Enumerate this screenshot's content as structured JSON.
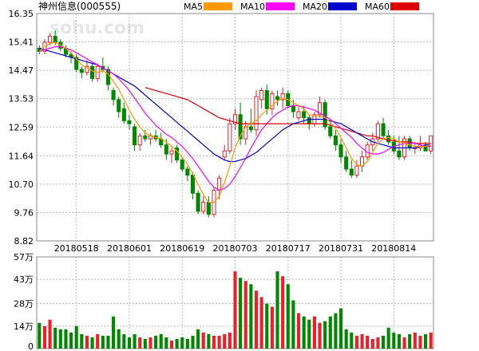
{
  "chart_data": [
    {
      "type": "candlestick",
      "title": "神州信息(000555)",
      "watermark": "sohu.com",
      "y_ticks": [
        "16.35",
        "15.41",
        "14.47",
        "13.53",
        "12.59",
        "11.64",
        "10.70",
        "9.76",
        "8.82"
      ],
      "ylim": [
        8.82,
        16.35
      ],
      "x_ticks": [
        "20180518",
        "20180601",
        "20180619",
        "20180703",
        "20180717",
        "20180731",
        "20180814"
      ],
      "grid": true,
      "colors": {
        "up": "#e8202a",
        "down": "#008800"
      },
      "legend": [
        {
          "name": "MA5",
          "color": "#ff9900"
        },
        {
          "name": "MA10",
          "color": "#ff00ff"
        },
        {
          "name": "MA20",
          "color": "#0000cc"
        },
        {
          "name": "MA60",
          "color": "#dd0000"
        }
      ],
      "candles": [
        [
          15.2,
          15.3,
          15.0,
          15.1
        ],
        [
          15.1,
          15.5,
          15.0,
          15.4
        ],
        [
          15.4,
          15.7,
          15.3,
          15.6
        ],
        [
          15.6,
          15.8,
          15.3,
          15.4
        ],
        [
          15.4,
          15.5,
          15.1,
          15.2
        ],
        [
          15.2,
          15.3,
          14.9,
          15.0
        ],
        [
          15.0,
          15.1,
          14.7,
          14.9
        ],
        [
          14.9,
          15.0,
          14.4,
          14.5
        ],
        [
          14.5,
          14.6,
          14.2,
          14.4
        ],
        [
          14.4,
          14.8,
          14.3,
          14.6
        ],
        [
          14.6,
          14.7,
          14.1,
          14.2
        ],
        [
          14.2,
          14.7,
          14.1,
          14.6
        ],
        [
          14.6,
          14.9,
          14.4,
          14.5
        ],
        [
          14.5,
          14.6,
          13.8,
          14.0
        ],
        [
          13.8,
          13.9,
          13.3,
          13.5
        ],
        [
          13.5,
          13.6,
          12.9,
          13.1
        ],
        [
          13.2,
          13.4,
          12.7,
          12.8
        ],
        [
          12.8,
          13.0,
          12.5,
          12.7
        ],
        [
          12.6,
          12.7,
          11.8,
          12.0
        ],
        [
          12.0,
          12.4,
          11.8,
          12.3
        ],
        [
          12.3,
          12.5,
          12.1,
          12.2
        ],
        [
          12.2,
          12.4,
          12.0,
          12.3
        ],
        [
          12.3,
          12.5,
          12.1,
          12.2
        ],
        [
          12.2,
          12.4,
          11.9,
          12.0
        ],
        [
          12.0,
          12.2,
          11.5,
          11.7
        ],
        [
          11.7,
          11.9,
          11.4,
          11.8
        ],
        [
          11.9,
          12.0,
          11.4,
          11.5
        ],
        [
          11.5,
          11.6,
          11.1,
          11.2
        ],
        [
          11.2,
          11.3,
          10.8,
          11.0
        ],
        [
          11.0,
          11.1,
          10.2,
          10.4
        ],
        [
          10.4,
          10.5,
          9.7,
          9.8
        ],
        [
          9.8,
          10.3,
          9.7,
          10.1
        ],
        [
          10.1,
          10.3,
          9.6,
          9.7
        ],
        [
          9.7,
          10.6,
          9.6,
          10.5
        ],
        [
          10.5,
          11.0,
          10.2,
          10.9
        ],
        [
          11.6,
          12.0,
          11.5,
          11.8
        ],
        [
          11.8,
          12.9,
          11.7,
          12.7
        ],
        [
          12.7,
          13.2,
          12.5,
          13.0
        ],
        [
          13.0,
          13.4,
          12.0,
          12.2
        ],
        [
          12.2,
          12.8,
          12.0,
          12.6
        ],
        [
          12.6,
          13.2,
          12.4,
          12.5
        ],
        [
          12.5,
          13.8,
          12.3,
          13.6
        ],
        [
          13.5,
          13.9,
          13.2,
          13.8
        ],
        [
          13.8,
          14.0,
          13.0,
          13.2
        ],
        [
          13.2,
          13.8,
          13.0,
          13.7
        ],
        [
          13.6,
          13.8,
          13.3,
          13.5
        ],
        [
          13.5,
          13.9,
          13.2,
          13.7
        ],
        [
          13.7,
          13.8,
          13.2,
          13.3
        ],
        [
          13.3,
          13.5,
          12.9,
          13.1
        ],
        [
          12.9,
          13.3,
          12.8,
          13.1
        ],
        [
          13.1,
          13.3,
          12.7,
          12.9
        ],
        [
          12.9,
          13.0,
          12.5,
          12.7
        ],
        [
          12.7,
          13.1,
          12.6,
          13.0
        ],
        [
          13.0,
          13.6,
          12.9,
          13.4
        ],
        [
          13.4,
          13.5,
          12.5,
          12.6
        ],
        [
          12.6,
          12.8,
          12.2,
          12.3
        ],
        [
          12.3,
          12.5,
          11.8,
          12.0
        ],
        [
          12.0,
          12.2,
          11.4,
          11.6
        ],
        [
          11.6,
          11.8,
          11.1,
          11.2
        ],
        [
          11.2,
          11.5,
          10.9,
          11.0
        ],
        [
          11.0,
          11.5,
          10.9,
          11.3
        ],
        [
          11.3,
          11.8,
          11.1,
          11.6
        ],
        [
          11.6,
          12.1,
          11.5,
          12.0
        ],
        [
          12.0,
          12.4,
          11.8,
          12.2
        ],
        [
          12.2,
          12.8,
          12.1,
          12.7
        ],
        [
          12.7,
          12.9,
          12.2,
          12.3
        ],
        [
          12.3,
          12.5,
          12.0,
          12.1
        ],
        [
          12.1,
          12.3,
          11.7,
          11.8
        ],
        [
          11.8,
          12.3,
          11.5,
          11.6
        ],
        [
          11.6,
          12.3,
          11.5,
          12.2
        ],
        [
          12.2,
          12.3,
          11.8,
          11.9
        ],
        [
          11.9,
          12.1,
          11.7,
          11.9
        ],
        [
          11.9,
          12.3,
          11.8,
          12.0
        ],
        [
          12.0,
          12.1,
          11.8,
          11.8
        ],
        [
          11.8,
          12.3,
          11.7,
          12.3
        ]
      ],
      "ma5": [
        15.1,
        15.25,
        15.35,
        15.4,
        15.3,
        15.2,
        15.05,
        14.85,
        14.65,
        14.55,
        14.45,
        14.4,
        14.45,
        14.35,
        14.1,
        13.85,
        13.5,
        13.15,
        12.85,
        12.6,
        12.4,
        12.3,
        12.25,
        12.2,
        12.1,
        11.95,
        11.8,
        11.6,
        11.35,
        11.05,
        10.7,
        10.35,
        10.1,
        10.1,
        10.3,
        10.75,
        11.3,
        11.9,
        12.3,
        12.6,
        12.7,
        12.8,
        13.0,
        13.15,
        13.3,
        13.45,
        13.55,
        13.5,
        13.4,
        13.3,
        13.2,
        13.0,
        12.95,
        12.95,
        12.9,
        12.75,
        12.55,
        12.25,
        11.9,
        11.55,
        11.35,
        11.3,
        11.45,
        11.75,
        12.05,
        12.2,
        12.25,
        12.2,
        12.1,
        12.05,
        12.0,
        11.95,
        11.95,
        11.95,
        12.0
      ],
      "ma10": [
        15.1,
        15.15,
        15.2,
        15.25,
        15.25,
        15.2,
        15.15,
        15.05,
        14.95,
        14.85,
        14.75,
        14.65,
        14.55,
        14.45,
        14.35,
        14.2,
        14.0,
        13.8,
        13.55,
        13.3,
        13.05,
        12.85,
        12.65,
        12.5,
        12.35,
        12.25,
        12.1,
        11.95,
        11.75,
        11.55,
        11.3,
        11.05,
        10.8,
        10.6,
        10.5,
        10.55,
        10.7,
        10.95,
        11.25,
        11.55,
        11.9,
        12.2,
        12.5,
        12.7,
        12.9,
        13.05,
        13.15,
        13.25,
        13.3,
        13.3,
        13.25,
        13.2,
        13.15,
        13.05,
        12.95,
        12.85,
        12.7,
        12.55,
        12.4,
        12.25,
        12.05,
        11.9,
        11.75,
        11.7,
        11.7,
        11.75,
        11.85,
        11.95,
        12.0,
        12.05,
        12.05,
        12.05,
        12.0,
        11.95,
        11.95
      ],
      "ma20": [
        15.2,
        15.15,
        15.1,
        15.05,
        15.0,
        14.95,
        14.9,
        14.85,
        14.8,
        14.75,
        14.7,
        14.65,
        14.55,
        14.45,
        14.35,
        14.25,
        14.15,
        14.05,
        13.95,
        13.8,
        13.65,
        13.5,
        13.35,
        13.2,
        13.05,
        12.9,
        12.75,
        12.6,
        12.45,
        12.3,
        12.15,
        12.0,
        11.85,
        11.7,
        11.6,
        11.5,
        11.45,
        11.45,
        11.5,
        11.55,
        11.65,
        11.75,
        11.9,
        12.05,
        12.2,
        12.35,
        12.5,
        12.6,
        12.7,
        12.75,
        12.8,
        12.85,
        12.85,
        12.85,
        12.85,
        12.8,
        12.75,
        12.7,
        12.6,
        12.5,
        12.4,
        12.3,
        12.2,
        12.1,
        12.05,
        12.0,
        11.95,
        11.9,
        11.9,
        11.9,
        11.9,
        11.9,
        11.95,
        12.0,
        12.0
      ],
      "ma60": [
        null,
        null,
        null,
        null,
        null,
        null,
        null,
        null,
        null,
        null,
        null,
        null,
        null,
        null,
        null,
        null,
        null,
        null,
        null,
        null,
        13.9,
        13.85,
        13.8,
        13.75,
        13.7,
        13.65,
        13.6,
        13.55,
        13.5,
        13.4,
        13.3,
        13.2,
        13.1,
        13.0,
        12.9,
        12.85,
        12.8,
        12.75,
        12.7,
        12.7,
        12.7,
        12.7,
        12.7,
        12.7,
        12.7,
        12.7,
        12.7,
        12.7,
        12.7,
        12.7,
        12.7,
        12.7,
        12.7,
        12.7,
        12.7,
        12.65,
        12.6,
        12.55,
        12.5,
        12.45,
        12.4,
        12.35,
        12.3,
        12.3,
        12.25,
        12.2,
        12.15,
        12.15,
        12.1,
        12.1,
        12.1,
        12.05,
        12.05,
        12.05,
        12.05
      ]
    },
    {
      "type": "bar",
      "y_ticks": [
        "57万",
        "43万",
        "28万",
        "14万",
        "0"
      ],
      "ylim": [
        0,
        57
      ],
      "unit": "万",
      "volumes": [
        16,
        14,
        18,
        13,
        12,
        12,
        10,
        14,
        9,
        8,
        7,
        9,
        8,
        8,
        20,
        12,
        9,
        7,
        9,
        7,
        6,
        7,
        8,
        9,
        7,
        5,
        6,
        7,
        6,
        8,
        12,
        10,
        9,
        8,
        8,
        9,
        10,
        48,
        44,
        42,
        40,
        36,
        32,
        28,
        26,
        48,
        45,
        40,
        30,
        22,
        20,
        18,
        20,
        16,
        17,
        20,
        22,
        25,
        12,
        10,
        8,
        9,
        8,
        6,
        7,
        8,
        13,
        10,
        9,
        7,
        9,
        10,
        8,
        9,
        10
      ]
    }
  ]
}
